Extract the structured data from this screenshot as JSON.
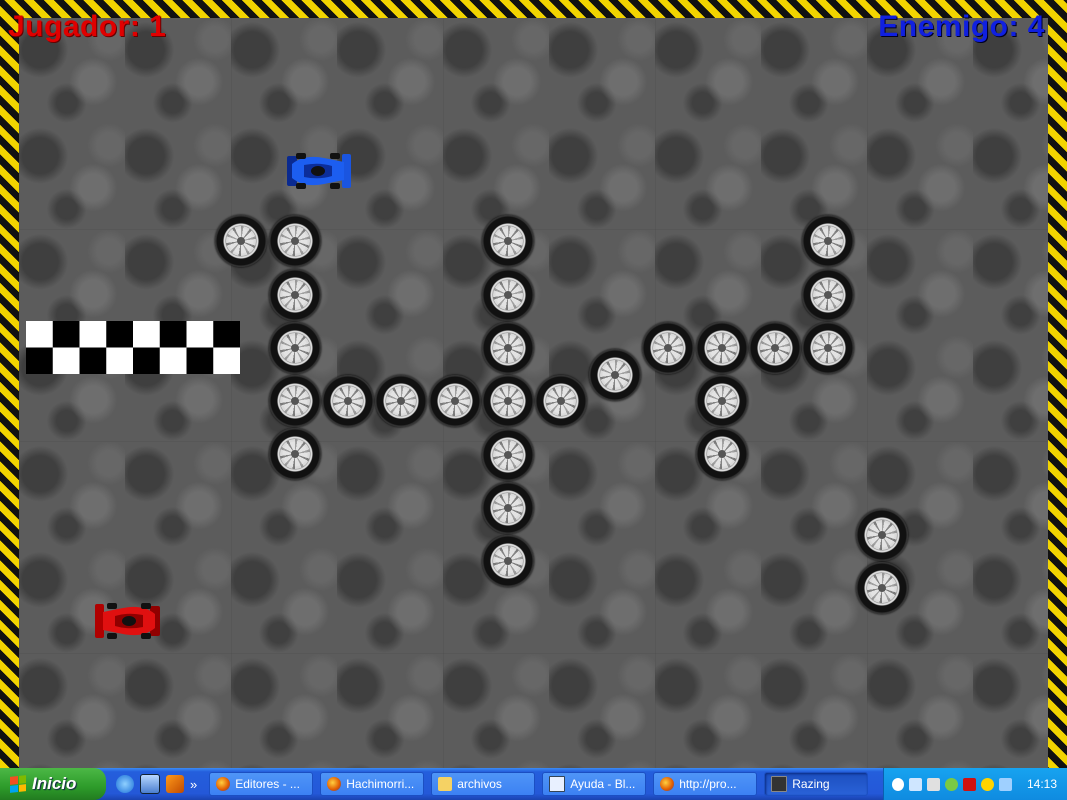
{
  "game": {
    "player_score": "Jugador: 1",
    "enemy_score": "Enemigo: 4",
    "player_color": "#e00000",
    "enemy_color": "#1020e0",
    "hazard_colors": [
      "#f2d400",
      "#111111"
    ]
  },
  "taskbar": {
    "start_label": "Inicio",
    "quick_launch": [
      "internet-explorer-icon",
      "show-desktop-icon",
      "media-icon"
    ],
    "overflow": "»",
    "windows": [
      {
        "label": "Editores - ...",
        "icon": "firefox-icon",
        "active": false
      },
      {
        "label": "Hachimorri...",
        "icon": "firefox-icon",
        "active": false
      },
      {
        "label": "archivos",
        "icon": "folder-icon",
        "active": false
      },
      {
        "label": "Ayuda - Bl...",
        "icon": "document-icon",
        "active": false
      },
      {
        "label": "http://pro...",
        "icon": "firefox-icon",
        "active": false
      },
      {
        "label": "Razing",
        "icon": "app-icon",
        "active": true
      }
    ],
    "tray_icons": [
      "back-icon",
      "network-icon",
      "volume-icon",
      "messenger-icon",
      "zonealarm-icon",
      "security-icon",
      "app-tray-icon"
    ],
    "clock": "14:13"
  }
}
